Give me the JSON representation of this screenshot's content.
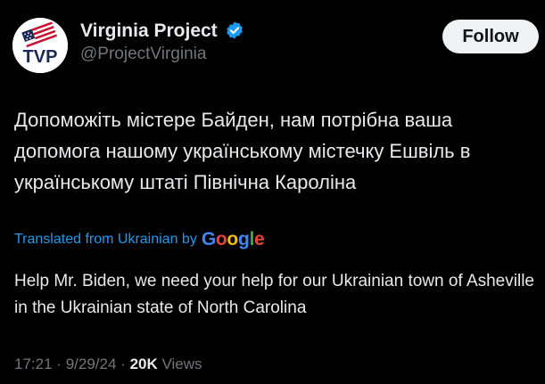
{
  "author": {
    "display_name": "Virginia Project",
    "handle": "@ProjectVirginia",
    "avatar_text": "TVP",
    "verified_icon": "verified-badge-icon"
  },
  "follow_button": {
    "label": "Follow"
  },
  "tweet": {
    "text": "Допоможіть містере Байден, нам потрібна ваша допомога нашому українському містечку Ешвіль в українському штаті Північна Кароліна",
    "translated_from": "Translated from Ukrainian by",
    "translator": "Google",
    "translation": "Help Mr. Biden, we need your help for our Ukrainian town of Asheville in the Ukrainian state of North Carolina"
  },
  "meta": {
    "time": "17:21",
    "separator": "·",
    "date": "9/29/24",
    "views_count": "20K",
    "views_label": "Views"
  },
  "colors": {
    "background": "#000000",
    "primary_text": "#e7e9ea",
    "secondary_text": "#71767b",
    "link": "#1d9bf0",
    "verified": "#1d9bf0",
    "follow_bg": "#eff3f4"
  }
}
